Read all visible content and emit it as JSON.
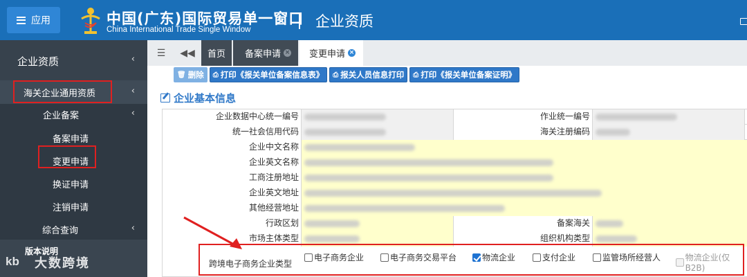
{
  "header": {
    "app_button_label": "应用",
    "title_cn": "中国(广东)国际贸易单一窗口",
    "title_en": "China International Trade Single Window",
    "page_title": "企业资质",
    "brand_color": "#1a6fb8"
  },
  "sidebar": {
    "section": "企业资质",
    "group": "海关企业通用资质",
    "subgroup": "企业备案",
    "items": [
      "备案申请",
      "变更申请",
      "换证申请",
      "注销申请"
    ],
    "query": "综合查询",
    "version": "版本说明",
    "watermark": "大数跨境",
    "watermark_logo": "kb"
  },
  "tabs": {
    "items": [
      {
        "label": "首页"
      },
      {
        "label": "备案申请"
      },
      {
        "label": "变更申请",
        "active": true
      }
    ]
  },
  "toolbar": {
    "buttons": [
      {
        "label": "删除",
        "icon": "trash-icon",
        "disabled": true
      },
      {
        "label": "打印《报关单位备案信息表》",
        "icon": "print-icon"
      },
      {
        "label": "报关人员信息打印",
        "icon": "print-icon"
      },
      {
        "label": "打印《报关单位备案证明》",
        "icon": "print-icon"
      }
    ]
  },
  "section_title": "企业基本信息",
  "form": {
    "fields": {
      "center_code": "企业数据中心统一编号",
      "job_code": "作业统一编号",
      "credit_code": "统一社会信用代码",
      "customs_code": "海关注册编码",
      "cn_name": "企业中文名称",
      "en_name": "企业英文名称",
      "reg_address": "工商注册地址",
      "en_address": "企业英文地址",
      "other_address": "其他经营地址",
      "district": "行政区划",
      "record_customs": "备案海关",
      "market_type": "市场主体类型",
      "org_type": "组织机构类型"
    },
    "ecommerce": {
      "label": "跨境电子商务企业类型",
      "options": [
        {
          "label": "电子商务企业",
          "checked": false
        },
        {
          "label": "电子商务交易平台",
          "checked": false
        },
        {
          "label": "物流企业",
          "checked": true
        },
        {
          "label": "支付企业",
          "checked": false
        },
        {
          "label": "监管场所经营人",
          "checked": false
        },
        {
          "label": "物流企业(仅B2B)",
          "checked": false,
          "disabled": true
        }
      ]
    }
  }
}
